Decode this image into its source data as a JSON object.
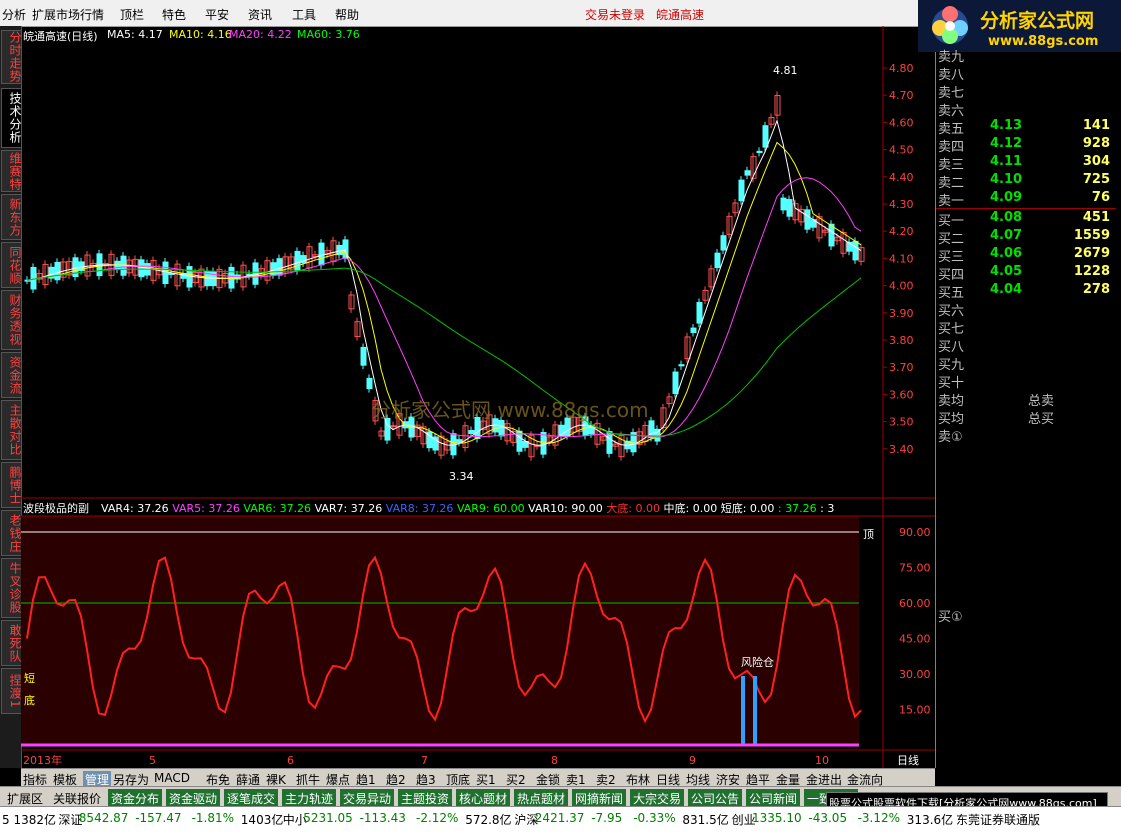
{
  "menu": {
    "items": [
      "分析",
      "扩展市场行情",
      "顶栏",
      "特色",
      "平安",
      "资讯",
      "工具",
      "帮助"
    ],
    "status_login": "交易未登录",
    "status_stock": "皖通高速"
  },
  "logo": {
    "text": "分析家公式网",
    "url": "www.88gs.com"
  },
  "left_tabs": [
    "分时走势",
    "技术分析",
    "维赛特",
    "新东方",
    "同花顺",
    "财务透视",
    "资金流",
    "主散对比",
    "鹏博士",
    "老钱庄",
    "牛叉诊股",
    "敢死队",
    "捏渡1"
  ],
  "main_chart": {
    "title": "皖通高速(日线)",
    "ma_labels": [
      {
        "text": "MA5: 4.17",
        "color": "#ffffff"
      },
      {
        "text": "MA10: 4.16",
        "color": "#ffff00"
      },
      {
        "text": "MA20: 4.22",
        "color": "#ff40ff"
      },
      {
        "text": "MA60: 3.76",
        "color": "#00ff00"
      }
    ],
    "high_label": "4.81",
    "low_label": "3.34",
    "watermark": "分析家公式网 www.88gs.com",
    "y_ticks": [
      "4.80",
      "4.70",
      "4.60",
      "4.50",
      "4.40",
      "4.30",
      "4.20",
      "4.10",
      "4.00",
      "3.90",
      "3.80",
      "3.70",
      "3.60",
      "3.50",
      "3.40"
    ]
  },
  "sub_chart": {
    "title": "波段极品的副",
    "vars": [
      {
        "text": "VAR4: 37.26",
        "color": "#ffffff"
      },
      {
        "text": "VAR5: 37.26",
        "color": "#ff40ff"
      },
      {
        "text": "VAR6: 37.26",
        "color": "#00ff00"
      },
      {
        "text": "VAR7: 37.26",
        "color": "#ffffff"
      },
      {
        "text": "VAR8: 37.26",
        "color": "#4060ff"
      },
      {
        "text": "VAR9: 60.00",
        "color": "#00ff00"
      },
      {
        "text": "VAR10: 90.00",
        "color": "#ffffff"
      },
      {
        "text": "大底: 0.00",
        "color": "#ff3030"
      },
      {
        "text": "中底: 0.00",
        "color": "#ffffff"
      },
      {
        "text": "短底: 0.00",
        "color": "#ffffff"
      },
      {
        "text": ": 37.26",
        "color": "#00ff00"
      },
      {
        "text": ": 3",
        "color": "#ffffff"
      }
    ],
    "y_ticks": [
      "90.00",
      "75.00",
      "60.00",
      "45.00",
      "30.00",
      "15.00"
    ],
    "top_label": "顶",
    "left_label_1": "短",
    "left_label_2": "底",
    "annotation": "风险仓"
  },
  "x_axis": {
    "labels": [
      "2013年",
      "5",
      "6",
      "7",
      "8",
      "9",
      "10"
    ],
    "period": "日线"
  },
  "order_book": {
    "sell": [
      {
        "label": "卖九",
        "price": "",
        "vol": ""
      },
      {
        "label": "卖八",
        "price": "",
        "vol": ""
      },
      {
        "label": "卖七",
        "price": "",
        "vol": ""
      },
      {
        "label": "卖六",
        "price": "",
        "vol": ""
      },
      {
        "label": "卖五",
        "price": "4.13",
        "vol": "141"
      },
      {
        "label": "卖四",
        "price": "4.12",
        "vol": "928"
      },
      {
        "label": "卖三",
        "price": "4.11",
        "vol": "304"
      },
      {
        "label": "卖二",
        "price": "4.10",
        "vol": "725"
      },
      {
        "label": "卖一",
        "price": "4.09",
        "vol": "76"
      }
    ],
    "buy": [
      {
        "label": "买一",
        "price": "4.08",
        "vol": "451"
      },
      {
        "label": "买二",
        "price": "4.07",
        "vol": "1559"
      },
      {
        "label": "买三",
        "price": "4.06",
        "vol": "2679"
      },
      {
        "label": "买四",
        "price": "4.05",
        "vol": "1228"
      },
      {
        "label": "买五",
        "price": "4.04",
        "vol": "278"
      },
      {
        "label": "买六",
        "price": "",
        "vol": ""
      },
      {
        "label": "买七",
        "price": "",
        "vol": ""
      },
      {
        "label": "买八",
        "price": "",
        "vol": ""
      },
      {
        "label": "买九",
        "price": "",
        "vol": ""
      },
      {
        "label": "买十",
        "price": "",
        "vol": ""
      }
    ],
    "avg_sell_label": "卖均",
    "total_sell_label": "总卖",
    "avg_buy_label": "买均",
    "total_buy_label": "总买",
    "sell_marker": "卖①",
    "buy_marker": "买①"
  },
  "indicator_tabs": [
    "指标",
    "模板",
    "管理",
    "另存为",
    "MACD",
    "布免",
    "薛通",
    "裸K",
    "抓牛",
    "爆点",
    "趋1",
    "趋2",
    "趋3",
    "顶底",
    "买1",
    "买2",
    "金锁",
    "卖1",
    "卖2",
    "布林",
    "日线",
    "均线",
    "济安",
    "趋平",
    "金量",
    "金进出",
    "金流向"
  ],
  "indicator_selected": "管理",
  "market_tabs": [
    "扩展区",
    "关联报价",
    "资金分布",
    "资金驱动",
    "逐笔成交",
    "主力轨迹",
    "交易异动",
    "主题投资",
    "核心题材",
    "热点题材",
    "网摘新闻",
    "大宗交易",
    "公司公告",
    "公司新闻",
    "一致预期"
  ],
  "ad_text": "股票公式股票软件下载[分析家公式网www.88gs.com]",
  "ticker": [
    {
      "text": "5 1382亿",
      "color": "#000000"
    },
    {
      "text": "深证",
      "color": "#000000"
    },
    {
      "text": "8542.87",
      "color": "#008000"
    },
    {
      "text": "-157.47",
      "color": "#008000"
    },
    {
      "text": "-1.81%",
      "color": "#008000"
    },
    {
      "text": "1403亿",
      "color": "#000000"
    },
    {
      "text": "中小",
      "color": "#000000"
    },
    {
      "text": "5231.05",
      "color": "#008000"
    },
    {
      "text": "-113.43",
      "color": "#008000"
    },
    {
      "text": "-2.12%",
      "color": "#008000"
    },
    {
      "text": "572.8亿",
      "color": "#000000"
    },
    {
      "text": "沪深",
      "color": "#000000"
    },
    {
      "text": "2421.37",
      "color": "#008000"
    },
    {
      "text": "-7.95",
      "color": "#008000"
    },
    {
      "text": "-0.33%",
      "color": "#008000"
    },
    {
      "text": "831.5亿",
      "color": "#000000"
    },
    {
      "text": "创业",
      "color": "#000000"
    },
    {
      "text": "1335.10",
      "color": "#008000"
    },
    {
      "text": "-43.05",
      "color": "#008000"
    },
    {
      "text": "-3.12%",
      "color": "#008000"
    },
    {
      "text": "313.6亿",
      "color": "#000000"
    },
    {
      "text": "东莞证券联通版",
      "color": "#000000"
    }
  ]
}
